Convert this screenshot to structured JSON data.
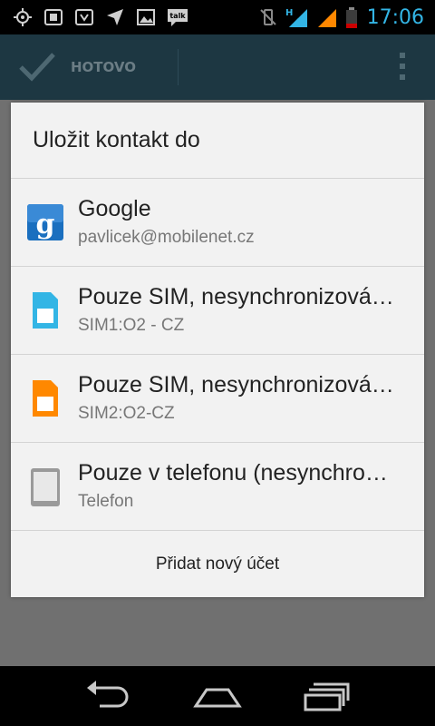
{
  "status_bar": {
    "time": "17:06",
    "network_type": "H",
    "icons_left": [
      "gps-icon",
      "screenshot-icon",
      "shield-notification-icon",
      "location-arrow-icon",
      "gallery-icon",
      "talk-icon"
    ],
    "talk_label": "talk",
    "icons_right": [
      "mute-vibrate-icon",
      "signal-icon",
      "signal-icon-2",
      "battery-icon"
    ],
    "colors": {
      "clock": "#33b5e5",
      "signal_primary": "#33b5e5",
      "signal_secondary": "#ff8800",
      "battery_low": "#cc0000"
    }
  },
  "app_bar": {
    "done_label": "HOTOVO",
    "colors": {
      "background": "#1d3742"
    }
  },
  "dialog": {
    "title": "Uložit kontakt do",
    "accounts": [
      {
        "name": "Google",
        "detail": "pavlicek@mobilenet.cz",
        "icon": "google-g-icon",
        "color": "#1a6fbf"
      },
      {
        "name": "Pouze SIM, nesynchronizová…",
        "detail": "SIM1:O2 - CZ",
        "icon": "sim-card-blue-icon",
        "color": "#33b5e5"
      },
      {
        "name": "Pouze SIM, nesynchronizová…",
        "detail": "SIM2:O2-CZ",
        "icon": "sim-card-orange-icon",
        "color": "#ff8800"
      },
      {
        "name": "Pouze v telefonu (nesynchro…",
        "detail": "Telefon",
        "icon": "phone-device-icon",
        "color": "#9a9a9a"
      }
    ],
    "add_account_label": "Přidat nový účet"
  },
  "nav_bar": {
    "buttons": [
      "back-icon",
      "home-icon",
      "recent-apps-icon"
    ]
  }
}
